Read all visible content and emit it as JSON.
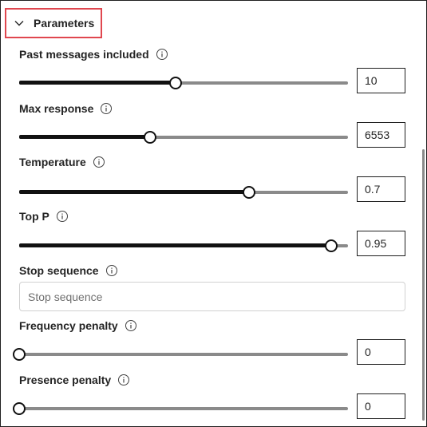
{
  "section": {
    "title": "Parameters",
    "expanded": true,
    "icon": "chevron-down-icon"
  },
  "params": [
    {
      "key": "past_messages",
      "label": "Past messages included",
      "value": "10",
      "fraction": 0.475
    },
    {
      "key": "max_response",
      "label": "Max response",
      "value": "6553",
      "fraction": 0.398
    },
    {
      "key": "temperature",
      "label": "Temperature",
      "value": "0.7",
      "fraction": 0.699
    },
    {
      "key": "top_p",
      "label": "Top P",
      "value": "0.95",
      "fraction": 0.95
    },
    {
      "key": "frequency_penalty",
      "label": "Frequency penalty",
      "value": "0",
      "fraction": 0.0
    },
    {
      "key": "presence_penalty",
      "label": "Presence penalty",
      "value": "0",
      "fraction": 0.0
    }
  ],
  "stop_sequence": {
    "label": "Stop sequence",
    "placeholder": "Stop sequence",
    "value": ""
  },
  "colors": {
    "highlight_border": "#e0474f",
    "slider_fill": "#111111",
    "slider_rail": "#8a8a8a"
  }
}
